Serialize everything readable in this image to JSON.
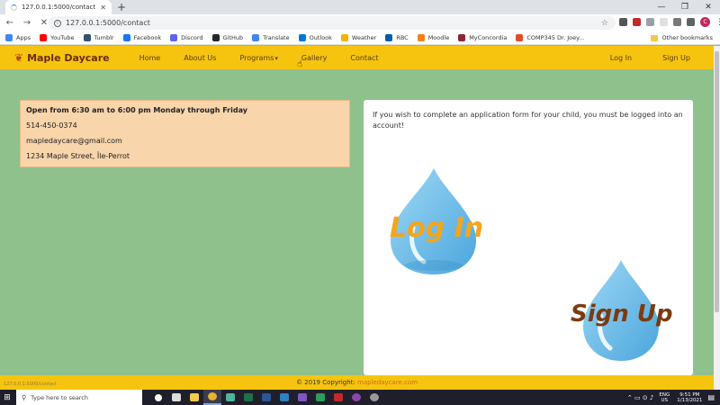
{
  "browser": {
    "tab_title": "127.0.0.1:5000/contact",
    "url": "127.0.0.1:5000/contact",
    "bookmarks": [
      {
        "label": "Apps",
        "color": "#4285f4"
      },
      {
        "label": "YouTube",
        "color": "#ff0000"
      },
      {
        "label": "Tumblr",
        "color": "#34526f"
      },
      {
        "label": "Facebook",
        "color": "#1877f2"
      },
      {
        "label": "Discord",
        "color": "#5865f2"
      },
      {
        "label": "GitHub",
        "color": "#24292e"
      },
      {
        "label": "Translate",
        "color": "#4285f4"
      },
      {
        "label": "Outlook",
        "color": "#0078d4"
      },
      {
        "label": "Weather",
        "color": "#f4b400"
      },
      {
        "label": "RBC",
        "color": "#005daa"
      },
      {
        "label": "Moodle",
        "color": "#f98012"
      },
      {
        "label": "MyConcordia",
        "color": "#912338"
      },
      {
        "label": "COMP345 Dr. Joey...",
        "color": "#e34c26"
      }
    ],
    "other_bookmarks": "Other bookmarks",
    "profile_initial": "C"
  },
  "site": {
    "brand": "Maple Daycare",
    "nav": {
      "home": "Home",
      "about": "About Us",
      "programs": "Programs",
      "gallery": "Gallery",
      "contact": "Contact",
      "login": "Log In",
      "signup": "Sign Up"
    },
    "contact": {
      "hours": "Open from 6:30 am to 6:00 pm Monday through Friday",
      "phone": "514-450-0374",
      "email": "mapledaycare@gmail.com",
      "address": "1234 Maple Street, Île-Perrot"
    },
    "panel": {
      "message": "If you wish to complete an application form for your child, you must be logged into an account!",
      "login_label": "Log In",
      "signup_label": "Sign Up"
    },
    "footer": {
      "prefix": "© 2019 Copyright:",
      "link": "mapledaycare.com"
    },
    "status_text": "127.0.0.1:5000/contact"
  },
  "taskbar": {
    "search_placeholder": "Type here to search",
    "lang_top": "ENG",
    "lang_bottom": "US",
    "time": "9:51 PM",
    "date": "1/13/2021"
  }
}
